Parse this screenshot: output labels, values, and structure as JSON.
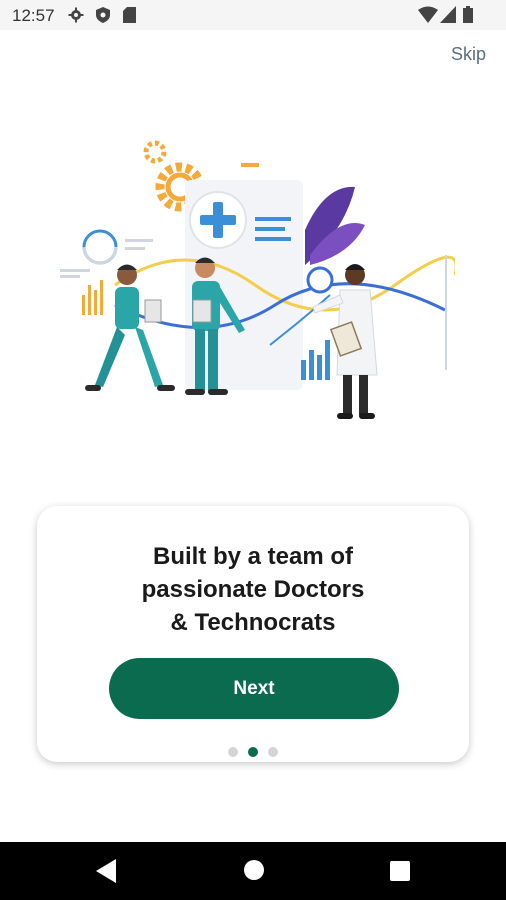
{
  "status_bar": {
    "time": "12:57",
    "left_icons": [
      "gear-icon",
      "shield-icon",
      "sd-card-icon"
    ],
    "right_icons": [
      "wifi-icon",
      "signal-icon",
      "battery-icon"
    ]
  },
  "header": {
    "skip_label": "Skip"
  },
  "card": {
    "title_lines": [
      "Built by a team of",
      "passionate Doctors",
      "& Technocrats"
    ],
    "next_label": "Next",
    "page_indicator": {
      "total": 3,
      "active_index": 1
    }
  },
  "colors": {
    "accent": "#0b6b4f",
    "dot_inactive": "#d5d5d5",
    "skip_text": "#5a6f7e"
  },
  "nav_bar": {
    "buttons": [
      "back-icon",
      "home-icon",
      "recents-icon"
    ]
  }
}
